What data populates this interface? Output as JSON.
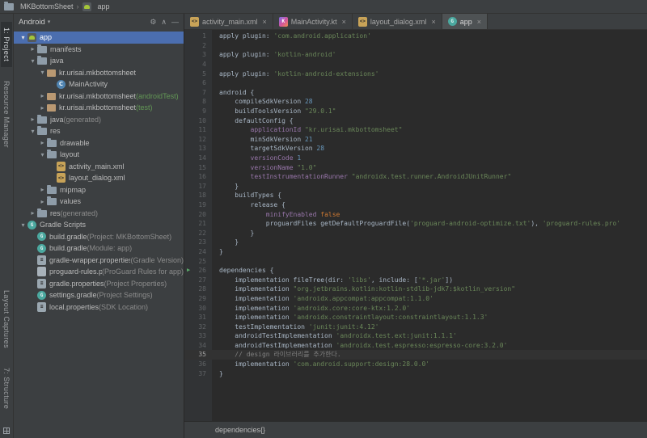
{
  "colors": {
    "selection": "#4B6EAF",
    "panel_bg": "#3C3F41",
    "editor_bg": "#2B2B2B",
    "android_green": "#A4C639",
    "caret_line": "#323232"
  },
  "topbar": {
    "project": "MKBottomSheet",
    "separator": "›",
    "module": "app"
  },
  "tool_strip": {
    "top": [
      {
        "label": "1: Project",
        "active": true
      },
      {
        "label": "Resource Manager",
        "active": false
      }
    ],
    "bottom": [
      {
        "label": "Layout Captures",
        "active": false
      },
      {
        "label": "7: Structure",
        "active": false
      }
    ]
  },
  "project_panel": {
    "view": "Android",
    "dropdown_glyph": "▾",
    "header_icons": [
      {
        "name": "settings-gear-icon",
        "glyph": "⚙"
      },
      {
        "name": "collapse-all-icon",
        "glyph": "∧"
      },
      {
        "name": "hide-panel-icon",
        "glyph": "—"
      }
    ],
    "tree": [
      {
        "label": "app",
        "depth": 0,
        "icon": "android-module",
        "chevron": "expanded",
        "selected": true
      },
      {
        "label": "manifests",
        "depth": 1,
        "icon": "folder",
        "chevron": "collapsed"
      },
      {
        "label": "java",
        "depth": 1,
        "icon": "folder",
        "chevron": "expanded"
      },
      {
        "label": "kr.urisai.mkbottomsheet",
        "depth": 2,
        "icon": "package",
        "chevron": "expanded"
      },
      {
        "label": "MainActivity",
        "depth": 3,
        "icon": "kotlin-class",
        "chevron": "none"
      },
      {
        "label": "kr.urisai.mkbottomsheet",
        "suffix": " (androidTest)",
        "suffix_style": "green",
        "depth": 2,
        "icon": "package",
        "chevron": "collapsed"
      },
      {
        "label": "kr.urisai.mkbottomsheet",
        "suffix": " (test)",
        "suffix_style": "green",
        "depth": 2,
        "icon": "package",
        "chevron": "collapsed"
      },
      {
        "label": "java",
        "suffix": " (generated)",
        "suffix_style": "muted",
        "depth": 1,
        "icon": "folder",
        "chevron": "collapsed"
      },
      {
        "label": "res",
        "depth": 1,
        "icon": "folder",
        "chevron": "expanded"
      },
      {
        "label": "drawable",
        "depth": 2,
        "icon": "folder",
        "chevron": "collapsed"
      },
      {
        "label": "layout",
        "depth": 2,
        "icon": "folder",
        "chevron": "expanded"
      },
      {
        "label": "activity_main.xml",
        "depth": 3,
        "icon": "xml-file",
        "chevron": "none"
      },
      {
        "label": "layout_dialog.xml",
        "depth": 3,
        "icon": "xml-file",
        "chevron": "none"
      },
      {
        "label": "mipmap",
        "depth": 2,
        "icon": "folder",
        "chevron": "collapsed"
      },
      {
        "label": "values",
        "depth": 2,
        "icon": "folder",
        "chevron": "collapsed"
      },
      {
        "label": "res",
        "suffix": " (generated)",
        "suffix_style": "muted",
        "depth": 1,
        "icon": "folder",
        "chevron": "collapsed"
      },
      {
        "label": "Gradle Scripts",
        "depth": 0,
        "icon": "gradle-file",
        "chevron": "expanded"
      },
      {
        "label": "build.gradle",
        "suffix": " (Project: MKBottomSheet)",
        "suffix_style": "muted",
        "depth": 1,
        "icon": "gradle-file",
        "chevron": "none"
      },
      {
        "label": "build.gradle",
        "suffix": " (Module: app)",
        "suffix_style": "muted",
        "depth": 1,
        "icon": "gradle-file",
        "chevron": "none"
      },
      {
        "label": "gradle-wrapper.properties",
        "suffix": " (Gradle Version)",
        "suffix_style": "muted",
        "depth": 1,
        "icon": "properties-file",
        "chevron": "none"
      },
      {
        "label": "proguard-rules.pro",
        "suffix": " (ProGuard Rules for app)",
        "suffix_style": "muted",
        "depth": 1,
        "icon": "file",
        "chevron": "none"
      },
      {
        "label": "gradle.properties",
        "suffix": " (Project Properties)",
        "suffix_style": "muted",
        "depth": 1,
        "icon": "properties-file",
        "chevron": "none"
      },
      {
        "label": "settings.gradle",
        "suffix": " (Project Settings)",
        "suffix_style": "muted",
        "depth": 1,
        "icon": "gradle-file",
        "chevron": "none"
      },
      {
        "label": "local.properties",
        "suffix": " (SDK Location)",
        "suffix_style": "muted",
        "depth": 1,
        "icon": "properties-file",
        "chevron": "none"
      }
    ]
  },
  "editor": {
    "tabs": [
      {
        "label": "activity_main.xml",
        "icon": "xml-file",
        "active": false
      },
      {
        "label": "MainActivity.kt",
        "icon": "kotlin-file",
        "active": false
      },
      {
        "label": "layout_dialog.xml",
        "icon": "xml-file",
        "active": false
      },
      {
        "label": "app",
        "icon": "gradle-file",
        "active": true
      }
    ],
    "close_glyph": "×",
    "caret_line": 35,
    "run_gutter_line": 26,
    "run_glyph": "▶",
    "lines": [
      {
        "n": 1,
        "s": [
          [
            "pl",
            "apply plugin: "
          ],
          [
            "st",
            "'com.android.application'"
          ]
        ]
      },
      {
        "n": 2,
        "s": []
      },
      {
        "n": 3,
        "s": [
          [
            "pl",
            "apply plugin: "
          ],
          [
            "st",
            "'kotlin-android'"
          ]
        ]
      },
      {
        "n": 4,
        "s": []
      },
      {
        "n": 5,
        "s": [
          [
            "pl",
            "apply plugin: "
          ],
          [
            "st",
            "'kotlin-android-extensions'"
          ]
        ]
      },
      {
        "n": 6,
        "s": []
      },
      {
        "n": 7,
        "s": [
          [
            "pl",
            "android {"
          ]
        ]
      },
      {
        "n": 8,
        "s": [
          [
            "pl",
            "    compileSdkVersion "
          ],
          [
            "nu",
            "28"
          ]
        ]
      },
      {
        "n": 9,
        "s": [
          [
            "pl",
            "    buildToolsVersion "
          ],
          [
            "st",
            "\"29.0.1\""
          ]
        ]
      },
      {
        "n": 10,
        "s": [
          [
            "pl",
            "    defaultConfig {"
          ]
        ]
      },
      {
        "n": 11,
        "s": [
          [
            "pl",
            "        "
          ],
          [
            "pr",
            "applicationId"
          ],
          [
            "pl",
            " "
          ],
          [
            "st",
            "\"kr.urisai.mkbottomsheet\""
          ]
        ]
      },
      {
        "n": 12,
        "s": [
          [
            "pl",
            "        minSdkVersion "
          ],
          [
            "nu",
            "21"
          ]
        ]
      },
      {
        "n": 13,
        "s": [
          [
            "pl",
            "        targetSdkVersion "
          ],
          [
            "nu",
            "28"
          ]
        ]
      },
      {
        "n": 14,
        "s": [
          [
            "pl",
            "        "
          ],
          [
            "pr",
            "versionCode"
          ],
          [
            "pl",
            " "
          ],
          [
            "nu",
            "1"
          ]
        ]
      },
      {
        "n": 15,
        "s": [
          [
            "pl",
            "        "
          ],
          [
            "pr",
            "versionName"
          ],
          [
            "pl",
            " "
          ],
          [
            "st",
            "\"1.0\""
          ]
        ]
      },
      {
        "n": 16,
        "s": [
          [
            "pl",
            "        "
          ],
          [
            "pr",
            "testInstrumentationRunner"
          ],
          [
            "pl",
            " "
          ],
          [
            "st",
            "\"androidx.test.runner.AndroidJUnitRunner\""
          ]
        ]
      },
      {
        "n": 17,
        "s": [
          [
            "pl",
            "    }"
          ]
        ]
      },
      {
        "n": 18,
        "s": [
          [
            "pl",
            "    buildTypes {"
          ]
        ]
      },
      {
        "n": 19,
        "s": [
          [
            "pl",
            "        release {"
          ]
        ]
      },
      {
        "n": 20,
        "s": [
          [
            "pl",
            "            "
          ],
          [
            "pr",
            "minifyEnabled"
          ],
          [
            "pl",
            " "
          ],
          [
            "kw",
            "false"
          ]
        ]
      },
      {
        "n": 21,
        "s": [
          [
            "pl",
            "            proguardFiles getDefaultProguardFile("
          ],
          [
            "st",
            "'proguard-android-optimize.txt'"
          ],
          [
            "pl",
            "), "
          ],
          [
            "st",
            "'proguard-rules.pro'"
          ]
        ]
      },
      {
        "n": 22,
        "s": [
          [
            "pl",
            "        }"
          ]
        ]
      },
      {
        "n": 23,
        "s": [
          [
            "pl",
            "    }"
          ]
        ]
      },
      {
        "n": 24,
        "s": [
          [
            "pl",
            "}"
          ]
        ]
      },
      {
        "n": 25,
        "s": []
      },
      {
        "n": 26,
        "s": [
          [
            "pl",
            "dependencies {"
          ]
        ]
      },
      {
        "n": 27,
        "s": [
          [
            "pl",
            "    implementation fileTree(dir: "
          ],
          [
            "st",
            "'libs'"
          ],
          [
            "pl",
            ", include: ["
          ],
          [
            "st",
            "'*.jar'"
          ],
          [
            "pl",
            "])"
          ]
        ]
      },
      {
        "n": 28,
        "s": [
          [
            "pl",
            "    implementation "
          ],
          [
            "st",
            "\"org.jetbrains.kotlin:kotlin-stdlib-jdk7:$kotlin_version\""
          ]
        ]
      },
      {
        "n": 29,
        "s": [
          [
            "pl",
            "    implementation "
          ],
          [
            "st",
            "'androidx.appcompat:appcompat:1.1.0'"
          ]
        ]
      },
      {
        "n": 30,
        "s": [
          [
            "pl",
            "    implementation "
          ],
          [
            "st",
            "'androidx.core:core-ktx:1.2.0'"
          ]
        ]
      },
      {
        "n": 31,
        "s": [
          [
            "pl",
            "    implementation "
          ],
          [
            "st",
            "'androidx.constraintlayout:constraintlayout:1.1.3'"
          ]
        ]
      },
      {
        "n": 32,
        "s": [
          [
            "pl",
            "    testImplementation "
          ],
          [
            "st",
            "'junit:junit:4.12'"
          ]
        ]
      },
      {
        "n": 33,
        "s": [
          [
            "pl",
            "    androidTestImplementation "
          ],
          [
            "st",
            "'androidx.test.ext:junit:1.1.1'"
          ]
        ]
      },
      {
        "n": 34,
        "s": [
          [
            "pl",
            "    androidTestImplementation "
          ],
          [
            "st",
            "'androidx.test.espresso:espresso-core:3.2.0'"
          ]
        ]
      },
      {
        "n": 35,
        "s": [
          [
            "cm",
            "    // design 라이브러리를 추가한다."
          ]
        ]
      },
      {
        "n": 36,
        "s": [
          [
            "pl",
            "    implementation "
          ],
          [
            "st",
            "'com.android.support:design:28.0.0'"
          ]
        ]
      },
      {
        "n": 37,
        "s": [
          [
            "pl",
            "}"
          ]
        ]
      }
    ]
  },
  "breadcrumb_bar": {
    "text": "dependencies{}"
  }
}
